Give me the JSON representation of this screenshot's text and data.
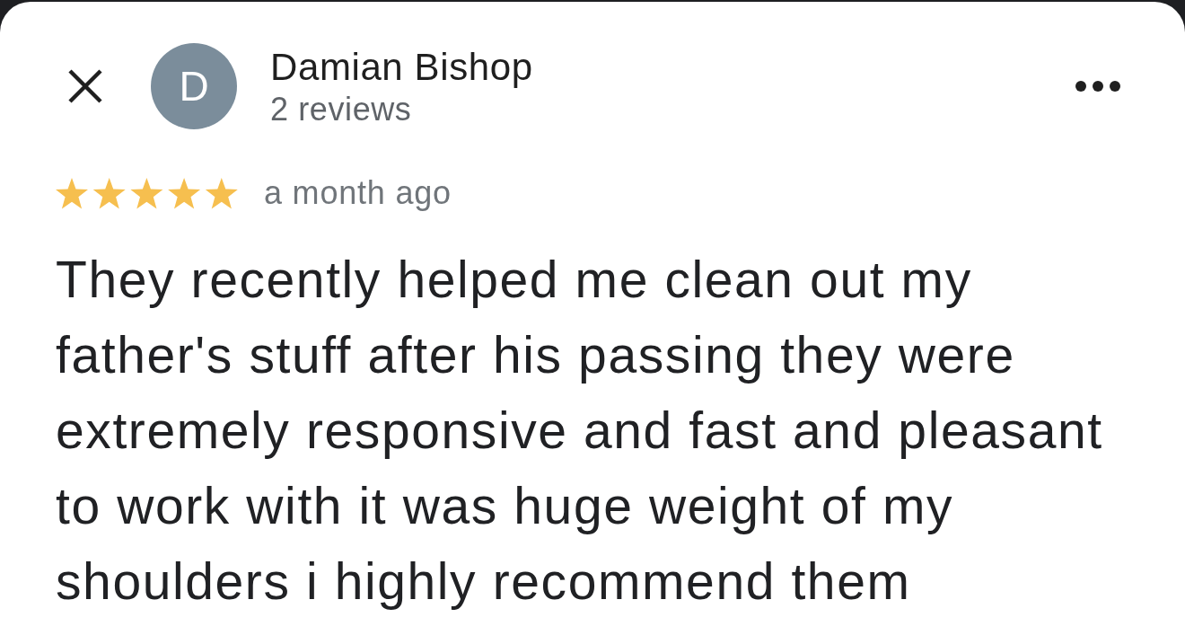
{
  "reviewer": {
    "avatar_letter": "D",
    "name": "Damian Bishop",
    "review_count": "2 reviews"
  },
  "review": {
    "stars": 5,
    "time": "a month ago",
    "text": "They recently helped me clean out my father's stuff after his passing they were extremely responsive and fast and pleasant to work with it was huge weight of my shoulders i highly recommend them"
  }
}
